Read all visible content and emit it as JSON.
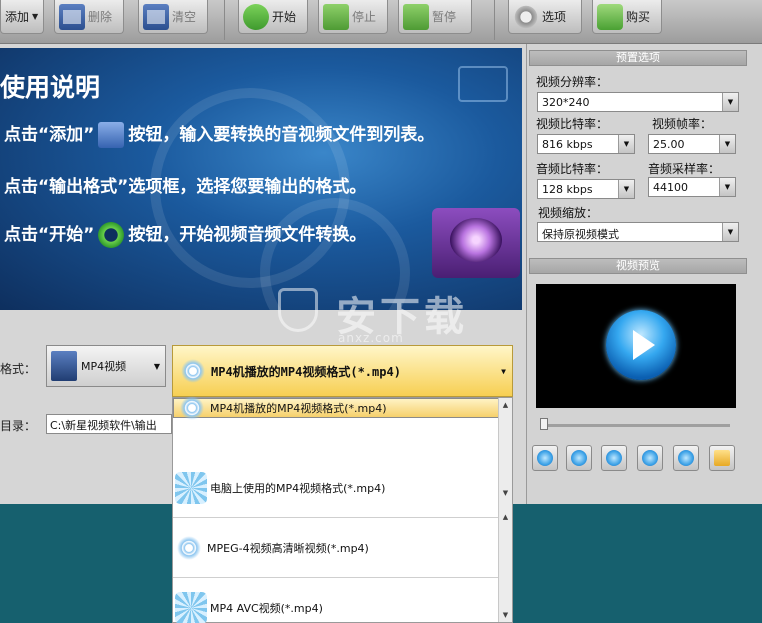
{
  "toolbar": {
    "add_label": "添加",
    "delete_label": "删除",
    "clear_label": "清空",
    "start_label": "开始",
    "stop_label": "停止",
    "pause_label": "暂停",
    "options_label": "选项",
    "buy_label": "购买"
  },
  "banner": {
    "title": "使用说明",
    "step1_pre": "点击“添加”",
    "step1_post": "按钮，输入要转换的音视频文件到列表。",
    "step2": "点击“输出格式”选项框，选择您要输出的格式。",
    "step3_pre": "点击“开始”",
    "step3_post": "按钮，开始视频音频文件转换。"
  },
  "output": {
    "format_label": "格式：",
    "format_value": "MP4视频",
    "profile_value": "MP4机播放的MP4视频格式(*.mp4)",
    "dir_label": "目录：",
    "dir_value": "C:\\新星视频软件\\输出"
  },
  "dropdown_items": [
    "MP4机播放的MP4视频格式(*.mp4)",
    "电脑上使用的MP4视频格式(*.mp4)",
    "MPEG-4视频高清晰视频(*.mp4)",
    "MP4 AVC视频(*.mp4)"
  ],
  "preset": {
    "header": "预置选项",
    "resolution_label": "视频分辨率：",
    "resolution_value": "320*240",
    "vbitrate_label": "视频比特率：",
    "vbitrate_value": "816 kbps",
    "framerate_label": "视频帧率：",
    "framerate_value": "25.00",
    "abitrate_label": "音频比特率：",
    "abitrate_value": "128 kbps",
    "samplerate_label": "音频采样率：",
    "samplerate_value": "44100",
    "scale_label": "视频缩放：",
    "scale_value": "保持原视频模式"
  },
  "preview": {
    "header": "视频预览"
  },
  "watermark": {
    "main": "安下载",
    "sub": "anxz.com"
  }
}
